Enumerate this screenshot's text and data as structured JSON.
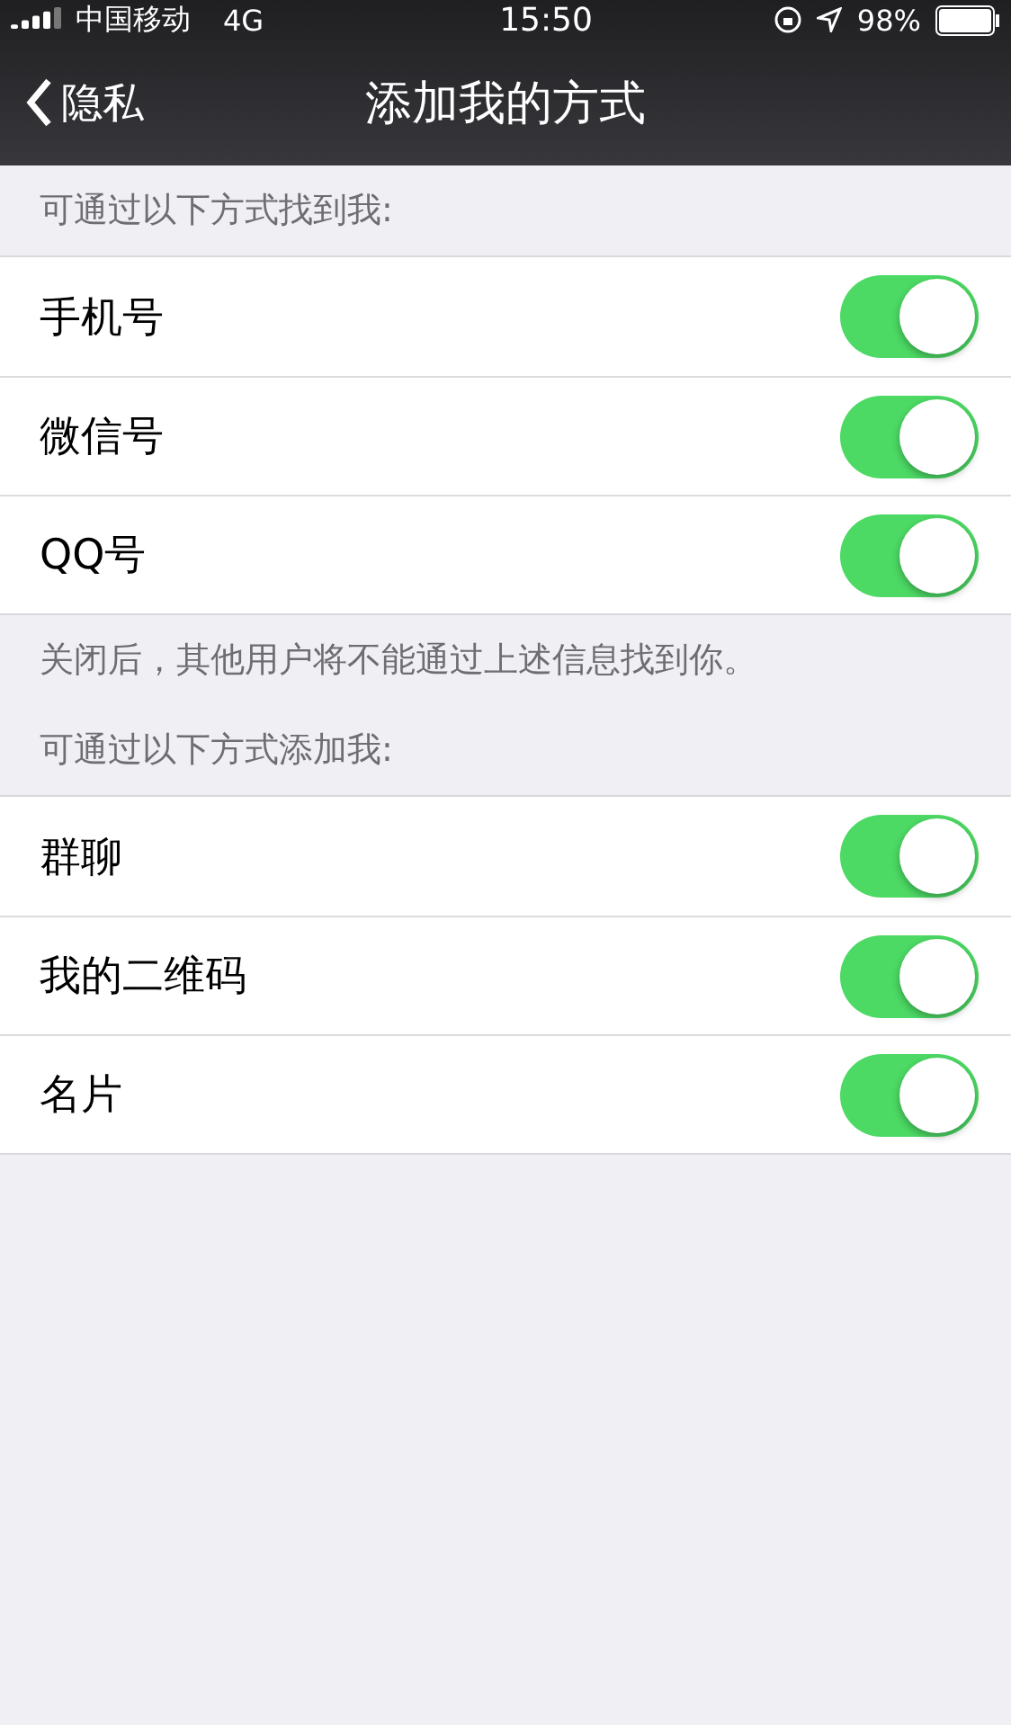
{
  "status_bar": {
    "carrier": "中国移动",
    "network": "4G",
    "time": "15:50",
    "battery": "98%"
  },
  "nav": {
    "back": "隐私",
    "title": "添加我的方式"
  },
  "sections": [
    {
      "header": "可通过以下方式找到我:",
      "footer": "关闭后，其他用户将不能通过上述信息找到你。",
      "rows": [
        {
          "label": "手机号",
          "on": true
        },
        {
          "label": "微信号",
          "on": true
        },
        {
          "label": "QQ号",
          "on": true
        }
      ]
    },
    {
      "header": "可通过以下方式添加我:",
      "rows": [
        {
          "label": "群聊",
          "on": true
        },
        {
          "label": "我的二维码",
          "on": true
        },
        {
          "label": "名片",
          "on": true
        }
      ]
    }
  ]
}
